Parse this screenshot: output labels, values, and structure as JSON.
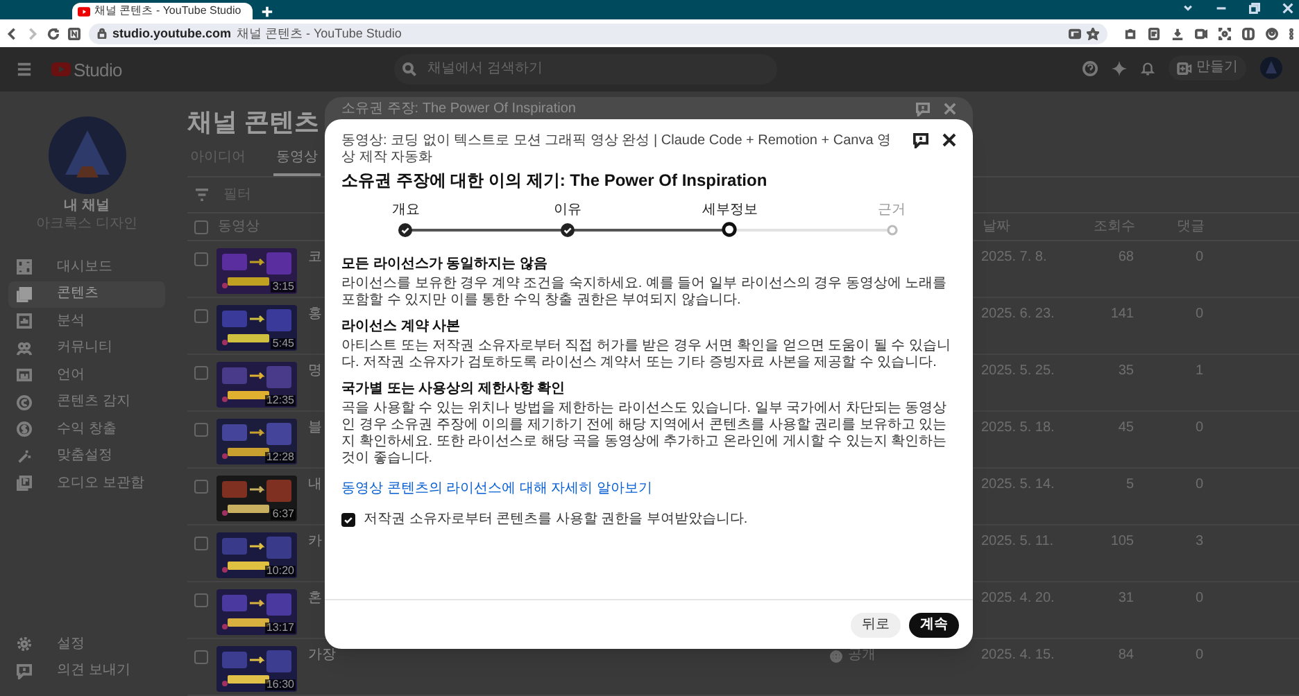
{
  "browser": {
    "tab_title": "채널 콘텐츠 - YouTube Studio",
    "address_domain": "studio.youtube.com",
    "address_title": "채널 콘텐츠 - YouTube Studio"
  },
  "header": {
    "logo": "Studio",
    "search_placeholder": "채널에서 검색하기",
    "create_button": "만들기"
  },
  "channel": {
    "name": "내 채널",
    "handle": "아크룩스 디자인"
  },
  "sidebar": {
    "items": [
      {
        "label": "대시보드",
        "selected": false
      },
      {
        "label": "콘텐츠",
        "selected": true
      },
      {
        "label": "분석",
        "selected": false
      },
      {
        "label": "커뮤니티",
        "selected": false
      },
      {
        "label": "언어",
        "selected": false
      },
      {
        "label": "콘텐츠 감지",
        "selected": false
      },
      {
        "label": "수익 창출",
        "selected": false
      },
      {
        "label": "맞춤설정",
        "selected": false
      },
      {
        "label": "오디오 보관함",
        "selected": false
      }
    ],
    "footer": [
      {
        "label": "설정"
      },
      {
        "label": "의견 보내기"
      }
    ]
  },
  "content": {
    "title": "채널 콘텐츠",
    "tabs": [
      {
        "label": "아이디어",
        "selected": false
      },
      {
        "label": "동영상",
        "selected": true
      }
    ],
    "filter_placeholder": "필터",
    "select_all_checked": false,
    "columns": [
      "동영상",
      "날짜",
      "조회수",
      "댓글"
    ],
    "rows": [
      {
        "checked": false,
        "title": "코",
        "duration": "3:15",
        "date": "2025. 7. 8.",
        "views": "68",
        "comments": "0"
      },
      {
        "checked": false,
        "title": "홍",
        "duration": "5:45",
        "date": "2025. 6. 23.",
        "views": "141",
        "comments": "0"
      },
      {
        "checked": false,
        "title": "명",
        "duration": "12:35",
        "date": "2025. 5. 25.",
        "views": "35",
        "comments": "1"
      },
      {
        "checked": false,
        "title": "블",
        "duration": "12:28",
        "date": "2025. 5. 18.",
        "views": "45",
        "comments": "0"
      },
      {
        "checked": false,
        "title": "내",
        "duration": "6:37",
        "date": "2025. 5. 14.",
        "views": "5",
        "comments": "0"
      },
      {
        "checked": false,
        "title": "카",
        "duration": "10:20",
        "date": "2025. 5. 11.",
        "views": "105",
        "comments": "3"
      },
      {
        "checked": false,
        "title": "혼",
        "duration": "13:17",
        "date": "2025. 4. 20.",
        "views": "31",
        "comments": "0"
      },
      {
        "checked": false,
        "title": "가장",
        "duration": "16:30",
        "date": "2025. 4. 15.",
        "views": "84",
        "comments": "0",
        "visibility": "공개"
      }
    ]
  },
  "back_dialog": {
    "title": "소유권 주장: The Power Of Inspiration"
  },
  "dialog": {
    "subtitle": "동영상: 코딩 없이 텍스트로 모션 그래픽 영상 완성 | Claude Code + Remotion + Canva 영상 제작 자동화",
    "title": "소유권 주장에 대한 이의 제기: The Power Of Inspiration",
    "steps": [
      {
        "label": "개요",
        "done": true,
        "selected": false
      },
      {
        "label": "이유",
        "done": true,
        "selected": false
      },
      {
        "label": "세부정보",
        "done": false,
        "selected": true
      },
      {
        "label": "근거",
        "done": false,
        "selected": false
      }
    ],
    "sections": [
      {
        "heading": "모든 라이선스가 동일하지는 않음",
        "body": "라이선스를 보유한 경우 계약 조건을 숙지하세요. 예를 들어 일부 라이선스의 경우 동영상에 노래를 포함할 수 있지만 이를 통한 수익 창출 권한은 부여되지 않습니다."
      },
      {
        "heading": "라이선스 계약 사본",
        "body": "아티스트 또는 저작권 소유자로부터 직접 허가를 받은 경우 서면 확인을 얻으면 도움이 될 수 있습니다. 저작권 소유자가 검토하도록 라이선스 계약서 또는 기타 증빙자료 사본을 제공할 수 있습니다."
      },
      {
        "heading": "국가별 또는 사용상의 제한사항 확인",
        "body": "곡을 사용할 수 있는 위치나 방법을 제한하는 라이선스도 있습니다. 일부 국가에서 차단되는 동영상인 경우 소유권 주장에 이의를 제기하기 전에 해당 지역에서 콘텐츠를 사용할 권리를 보유하고 있는지 확인하세요. 또한 라이선스로 해당 곡을 동영상에 추가하고 온라인에 게시할 수 있는지 확인하는 것이 좋습니다."
      }
    ],
    "link": "동영상 콘텐츠의 라이선스에 대해 자세히 알아보기",
    "checkbox": {
      "label": "저작권 소유자로부터 콘텐츠를 사용할 권한을 부여받았습니다.",
      "checked": true
    },
    "buttons": [
      {
        "label": "뒤로",
        "kind": "secondary"
      },
      {
        "label": "계속",
        "kind": "primary"
      }
    ]
  }
}
